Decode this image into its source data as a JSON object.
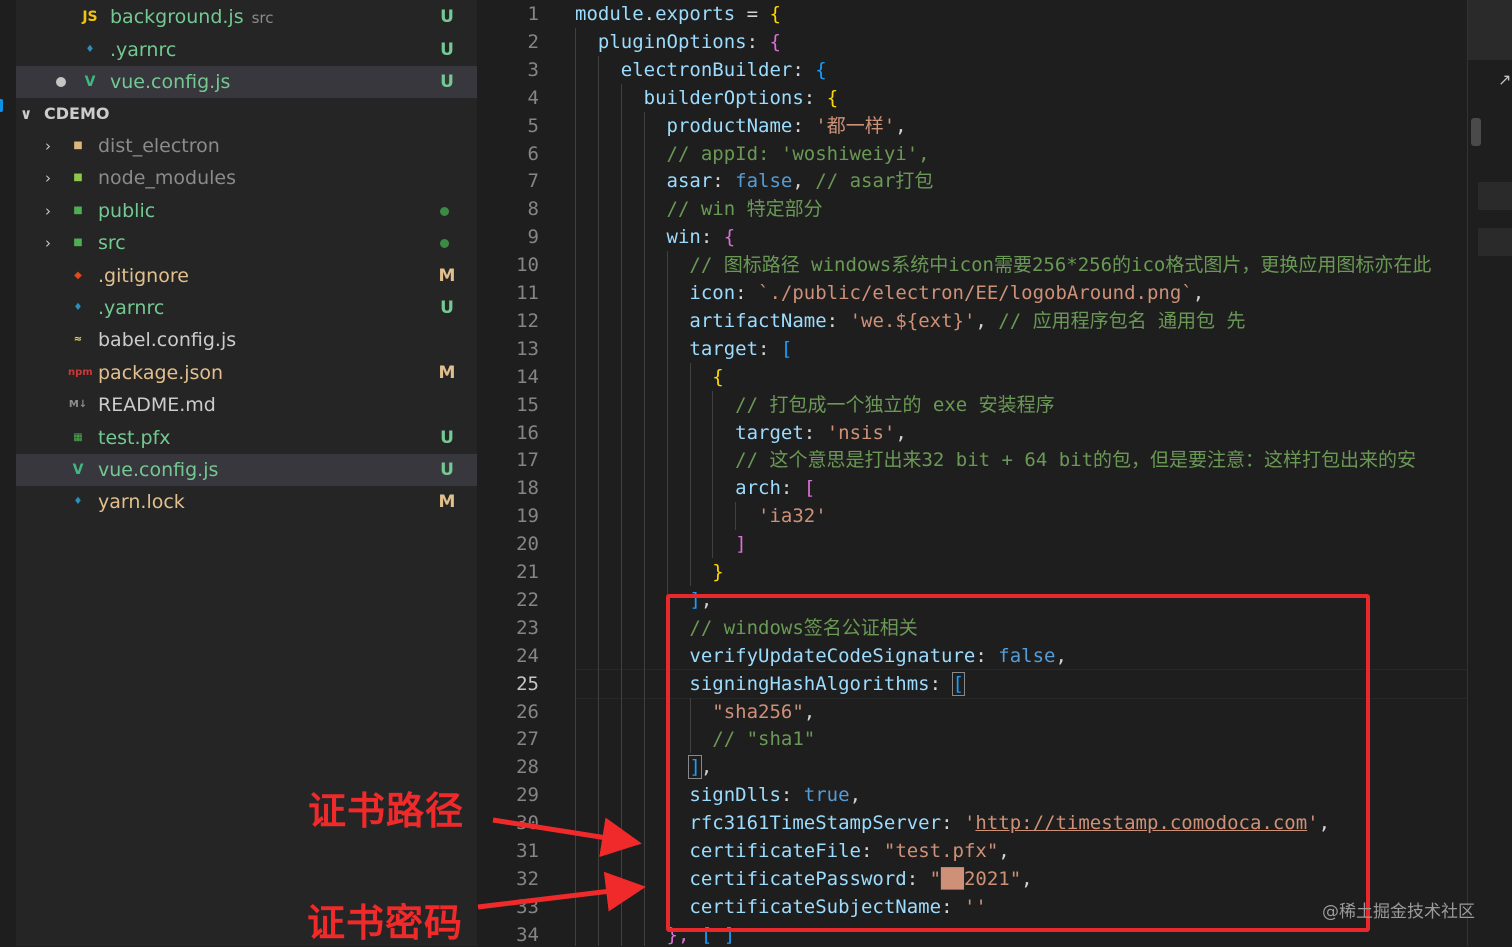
{
  "explorer": {
    "open_editors": [
      {
        "name": "background.js",
        "desc": "src",
        "icon": "JS",
        "icon_color": "#f1c40f",
        "badge": "U",
        "badge_color": "#73c991",
        "label_color": "#73c991"
      },
      {
        "name": ".yarnrc",
        "icon": "yarn-icon",
        "badge": "U",
        "badge_color": "#73c991",
        "label_color": "#73c991"
      },
      {
        "name": "vue.config.js",
        "icon": "vue-icon",
        "badge": "U",
        "badge_color": "#73c991",
        "label_color": "#73c991",
        "modified": true
      }
    ],
    "section_title": "CDEMO",
    "items": [
      {
        "name": "dist_electron",
        "type": "folder",
        "icon": "folder-icon",
        "label_color": "#8b8b8b"
      },
      {
        "name": "node_modules",
        "type": "folder",
        "icon": "node-folder-icon",
        "label_color": "#8b8b8b"
      },
      {
        "name": "public",
        "type": "folder",
        "icon": "public-folder-icon",
        "label_color": "#73c991",
        "dot": true
      },
      {
        "name": "src",
        "type": "folder",
        "icon": "src-folder-icon",
        "label_color": "#73c991",
        "dot": true
      },
      {
        "name": ".gitignore",
        "icon": "git-icon",
        "badge": "M",
        "badge_color": "#e2c08d",
        "label_color": "#e2c08d"
      },
      {
        "name": ".yarnrc",
        "icon": "yarn-icon",
        "badge": "U",
        "badge_color": "#73c991",
        "label_color": "#73c991"
      },
      {
        "name": "babel.config.js",
        "icon": "babel-icon",
        "label_color": "#cccccc"
      },
      {
        "name": "package.json",
        "icon": "npm-icon",
        "badge": "M",
        "badge_color": "#e2c08d",
        "label_color": "#e2c08d"
      },
      {
        "name": "README.md",
        "icon": "markdown-icon",
        "label_color": "#cccccc"
      },
      {
        "name": "test.pfx",
        "icon": "certificate-icon",
        "badge": "U",
        "badge_color": "#73c991",
        "label_color": "#73c991"
      },
      {
        "name": "vue.config.js",
        "icon": "vue-icon",
        "badge": "U",
        "badge_color": "#73c991",
        "label_color": "#73c991",
        "active": true
      },
      {
        "name": "yarn.lock",
        "icon": "yarn-icon",
        "badge": "M",
        "badge_color": "#e2c08d",
        "label_color": "#e2c08d"
      }
    ]
  },
  "editor": {
    "current_line": 25,
    "lines": [
      {
        "n": "1",
        "segs": [
          [
            "k",
            "module"
          ],
          [
            "p",
            "."
          ],
          [
            "k",
            "exports"
          ],
          [
            "p",
            " = "
          ],
          [
            "b1",
            "{"
          ]
        ]
      },
      {
        "n": "2",
        "segs": [
          [
            "p",
            "  "
          ],
          [
            "k",
            "pluginOptions"
          ],
          [
            "p",
            ": "
          ],
          [
            "b2",
            "{"
          ]
        ]
      },
      {
        "n": "3",
        "segs": [
          [
            "p",
            "    "
          ],
          [
            "k",
            "electronBuilder"
          ],
          [
            "p",
            ": "
          ],
          [
            "b3",
            "{"
          ]
        ]
      },
      {
        "n": "4",
        "segs": [
          [
            "p",
            "      "
          ],
          [
            "k",
            "builderOptions"
          ],
          [
            "p",
            ": "
          ],
          [
            "b1",
            "{"
          ]
        ]
      },
      {
        "n": "5",
        "segs": [
          [
            "p",
            "        "
          ],
          [
            "k",
            "productName"
          ],
          [
            "p",
            ": "
          ],
          [
            "s",
            "'都一样'"
          ],
          [
            "p",
            ","
          ]
        ]
      },
      {
        "n": "6",
        "segs": [
          [
            "p",
            "        "
          ],
          [
            "c",
            "// appId: 'woshiweiyi',"
          ]
        ]
      },
      {
        "n": "7",
        "segs": [
          [
            "p",
            "        "
          ],
          [
            "k",
            "asar"
          ],
          [
            "p",
            ": "
          ],
          [
            "kw",
            "false"
          ],
          [
            "p",
            ", "
          ],
          [
            "c",
            "// asar打包"
          ]
        ]
      },
      {
        "n": "8",
        "segs": [
          [
            "p",
            "        "
          ],
          [
            "c",
            "// win 特定部分"
          ]
        ]
      },
      {
        "n": "9",
        "segs": [
          [
            "p",
            "        "
          ],
          [
            "k",
            "win"
          ],
          [
            "p",
            ": "
          ],
          [
            "b2",
            "{"
          ]
        ]
      },
      {
        "n": "10",
        "segs": [
          [
            "p",
            "          "
          ],
          [
            "c",
            "// 图标路径 windows系统中icon需要256*256的ico格式图片，更换应用图标亦在此"
          ]
        ]
      },
      {
        "n": "11",
        "segs": [
          [
            "p",
            "          "
          ],
          [
            "k",
            "icon"
          ],
          [
            "p",
            ": "
          ],
          [
            "s",
            "`./public/electron/EE/logobAround.png`"
          ],
          [
            "p",
            ","
          ]
        ]
      },
      {
        "n": "12",
        "segs": [
          [
            "p",
            "          "
          ],
          [
            "k",
            "artifactName"
          ],
          [
            "p",
            ": "
          ],
          [
            "s",
            "'we.${ext}'"
          ],
          [
            "p",
            ", "
          ],
          [
            "c",
            "// 应用程序包名 通用包 先"
          ]
        ]
      },
      {
        "n": "13",
        "segs": [
          [
            "p",
            "          "
          ],
          [
            "k",
            "target"
          ],
          [
            "p",
            ": "
          ],
          [
            "b3",
            "["
          ]
        ]
      },
      {
        "n": "14",
        "segs": [
          [
            "p",
            "            "
          ],
          [
            "b1",
            "{"
          ]
        ]
      },
      {
        "n": "15",
        "segs": [
          [
            "p",
            "              "
          ],
          [
            "c",
            "// 打包成一个独立的 exe 安装程序"
          ]
        ]
      },
      {
        "n": "16",
        "segs": [
          [
            "p",
            "              "
          ],
          [
            "k",
            "target"
          ],
          [
            "p",
            ": "
          ],
          [
            "s",
            "'nsis'"
          ],
          [
            "p",
            ","
          ]
        ]
      },
      {
        "n": "17",
        "segs": [
          [
            "p",
            "              "
          ],
          [
            "c",
            "// 这个意思是打出来32 bit + 64 bit的包，但是要注意：这样打包出来的安"
          ]
        ]
      },
      {
        "n": "18",
        "segs": [
          [
            "p",
            "              "
          ],
          [
            "k",
            "arch"
          ],
          [
            "p",
            ": "
          ],
          [
            "b2",
            "["
          ]
        ]
      },
      {
        "n": "19",
        "segs": [
          [
            "p",
            "                "
          ],
          [
            "s",
            "'ia32'"
          ]
        ]
      },
      {
        "n": "20",
        "segs": [
          [
            "p",
            "              "
          ],
          [
            "b2",
            "]"
          ]
        ]
      },
      {
        "n": "21",
        "segs": [
          [
            "p",
            "            "
          ],
          [
            "b1",
            "}"
          ]
        ]
      },
      {
        "n": "22",
        "segs": [
          [
            "p",
            "          "
          ],
          [
            "b3",
            "]"
          ],
          [
            "p",
            ","
          ]
        ]
      },
      {
        "n": "23",
        "segs": [
          [
            "p",
            "          "
          ],
          [
            "c",
            "// windows签名公证相关"
          ]
        ]
      },
      {
        "n": "24",
        "segs": [
          [
            "p",
            "          "
          ],
          [
            "k",
            "verifyUpdateCodeSignature"
          ],
          [
            "p",
            ": "
          ],
          [
            "kw",
            "false"
          ],
          [
            "p",
            ","
          ]
        ]
      },
      {
        "n": "25",
        "segs": [
          [
            "p",
            "          "
          ],
          [
            "k",
            "signingHashAlgorithms"
          ],
          [
            "p",
            ": "
          ],
          [
            "b3m",
            "["
          ]
        ]
      },
      {
        "n": "26",
        "segs": [
          [
            "p",
            "            "
          ],
          [
            "s",
            "\"sha256\""
          ],
          [
            "p",
            ","
          ]
        ]
      },
      {
        "n": "27",
        "segs": [
          [
            "p",
            "            "
          ],
          [
            "c",
            "// \"sha1\""
          ]
        ]
      },
      {
        "n": "28",
        "segs": [
          [
            "p",
            "          "
          ],
          [
            "b3m",
            "]"
          ],
          [
            "p",
            ","
          ]
        ]
      },
      {
        "n": "29",
        "segs": [
          [
            "p",
            "          "
          ],
          [
            "k",
            "signDlls"
          ],
          [
            "p",
            ": "
          ],
          [
            "kw",
            "true"
          ],
          [
            "p",
            ","
          ]
        ]
      },
      {
        "n": "30",
        "segs": [
          [
            "p",
            "          "
          ],
          [
            "k",
            "rfc3161TimeStampServer"
          ],
          [
            "p",
            ": "
          ],
          [
            "s",
            "'"
          ],
          [
            "su",
            "http://timestamp.comodoca.com"
          ],
          [
            "s",
            "'"
          ],
          [
            "p",
            ","
          ]
        ]
      },
      {
        "n": "31",
        "segs": [
          [
            "p",
            "          "
          ],
          [
            "k",
            "certificateFile"
          ],
          [
            "p",
            ": "
          ],
          [
            "s",
            "\"test.pfx\""
          ],
          [
            "p",
            ","
          ]
        ]
      },
      {
        "n": "32",
        "segs": [
          [
            "p",
            "          "
          ],
          [
            "k",
            "certificatePassword"
          ],
          [
            "p",
            ": "
          ],
          [
            "s",
            "\"██2021\""
          ],
          [
            "p",
            ","
          ]
        ]
      },
      {
        "n": "33",
        "segs": [
          [
            "p",
            "          "
          ],
          [
            "k",
            "certificateSubjectName"
          ],
          [
            "p",
            ": "
          ],
          [
            "s",
            "''"
          ]
        ]
      },
      {
        "n": "34",
        "segs": [
          [
            "p",
            "        "
          ],
          [
            "b2",
            "},"
          ],
          [
            "p",
            " "
          ],
          [
            "b3",
            "["
          ],
          [
            "p",
            " "
          ],
          [
            "b3",
            "]"
          ]
        ]
      }
    ]
  },
  "annotations": {
    "cert_path_label": "证书路径",
    "cert_password_label": "证书密码",
    "highlight_color": "#e8282b"
  },
  "watermark": "@稀土掘金技术社区"
}
